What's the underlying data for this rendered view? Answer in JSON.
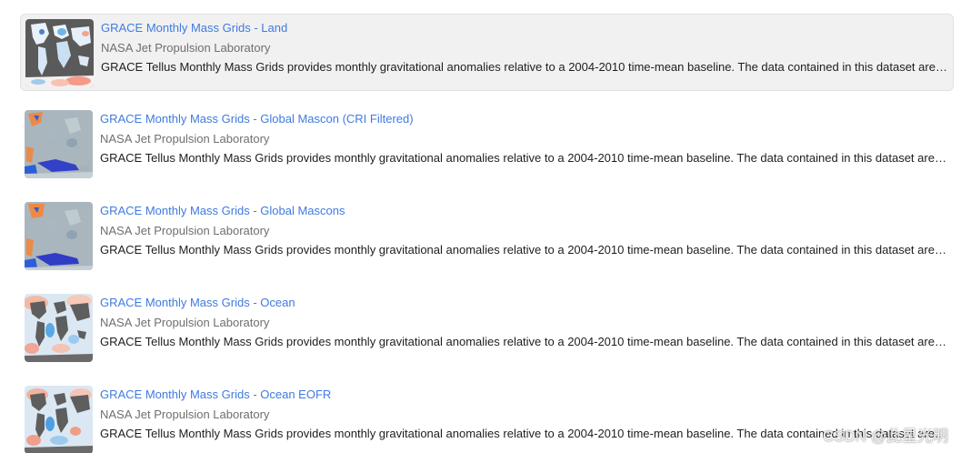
{
  "results": [
    {
      "title": "GRACE Monthly Mass Grids - Land",
      "provider": "NASA Jet Propulsion Laboratory",
      "description": "GRACE Tellus Monthly Mass Grids provides monthly gravitational anomalies relative to a 2004-2010 time-mean baseline. The data contained in this dataset are u...",
      "thumbnail_icon": "grace-land-map-thumbnail",
      "selected": true
    },
    {
      "title": "GRACE Monthly Mass Grids - Global Mascon (CRI Filtered)",
      "provider": "NASA Jet Propulsion Laboratory",
      "description": "GRACE Tellus Monthly Mass Grids provides monthly gravitational anomalies relative to a 2004-2010 time-mean baseline. The data contained in this dataset are u...",
      "thumbnail_icon": "grace-mascon-cri-map-thumbnail",
      "selected": false
    },
    {
      "title": "GRACE Monthly Mass Grids - Global Mascons",
      "provider": "NASA Jet Propulsion Laboratory",
      "description": "GRACE Tellus Monthly Mass Grids provides monthly gravitational anomalies relative to a 2004-2010 time-mean baseline. The data contained in this dataset are u...",
      "thumbnail_icon": "grace-mascons-map-thumbnail",
      "selected": false
    },
    {
      "title": "GRACE Monthly Mass Grids - Ocean",
      "provider": "NASA Jet Propulsion Laboratory",
      "description": "GRACE Tellus Monthly Mass Grids provides monthly gravitational anomalies relative to a 2004-2010 time-mean baseline. The data contained in this dataset are u...",
      "thumbnail_icon": "grace-ocean-map-thumbnail",
      "selected": false
    },
    {
      "title": "GRACE Monthly Mass Grids - Ocean EOFR",
      "provider": "NASA Jet Propulsion Laboratory",
      "description": "GRACE Tellus Monthly Mass Grids provides monthly gravitational anomalies relative to a 2004-2010 time-mean baseline. The data contained in this dataset are u...",
      "thumbnail_icon": "grace-ocean-eofr-map-thumbnail",
      "selected": false
    }
  ],
  "watermark": "CSDN @此星光明",
  "colors": {
    "link": "#3f7be0",
    "provider": "#6f6f6f",
    "description": "#1e1e1e",
    "selected_background": "#f1f1f1"
  }
}
